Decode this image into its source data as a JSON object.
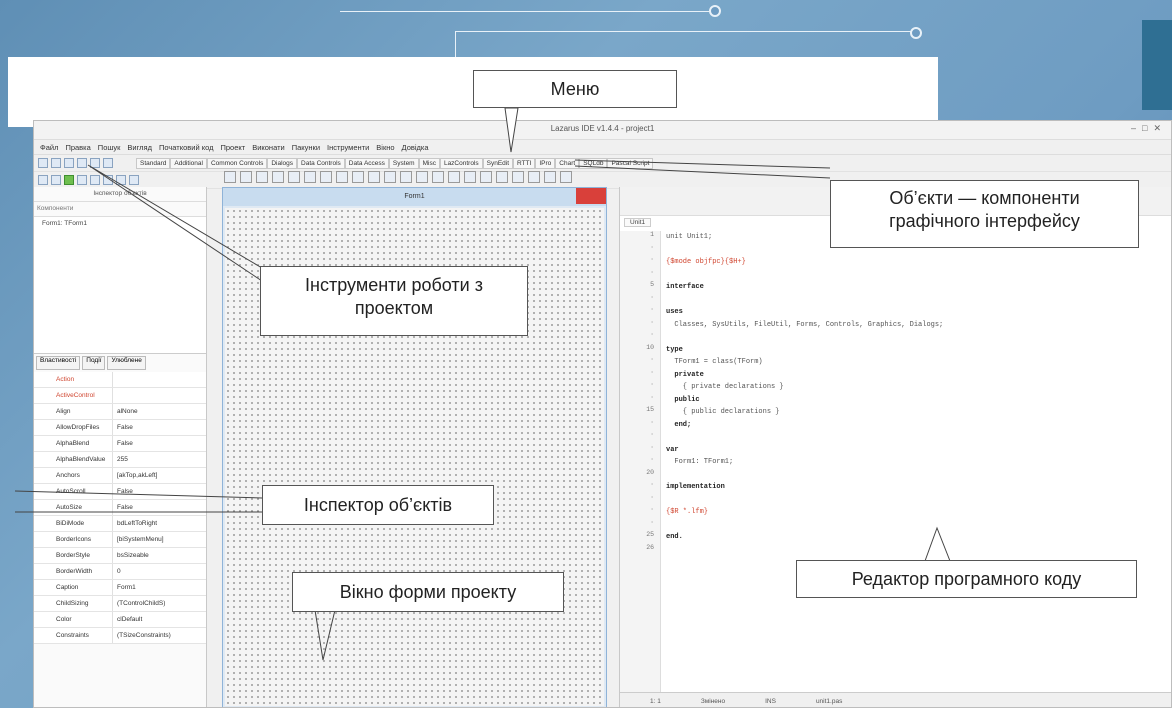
{
  "callouts": {
    "menu": "Меню",
    "objects": "Об’єкти — компоненти графічного інтерфейсу",
    "tools": "Інструменти роботи з проектом",
    "inspector": "Інспектор об’єктів",
    "form_window": "Вікно форми проекту",
    "code_editor": "Редактор програмного коду"
  },
  "ide": {
    "title": "Lazarus IDE v1.4.4 - project1",
    "menu_items": [
      "Файл",
      "Правка",
      "Пошук",
      "Вигляд",
      "Початковий код",
      "Проект",
      "Виконати",
      "Пакунки",
      "Інструменти",
      "Вікно",
      "Довідка"
    ],
    "palette_tabs": [
      "Standard",
      "Additional",
      "Common Controls",
      "Dialogs",
      "Data Controls",
      "Data Access",
      "System",
      "Misc",
      "LazControls",
      "SynEdit",
      "RTTI",
      "IPro",
      "Chart",
      "SQLdb",
      "Pascal Script"
    ]
  },
  "inspector": {
    "header": "Інспектор об'єктів",
    "search_label": "Компоненти",
    "tree_item": "Form1: TForm1",
    "tabs": [
      "Властивості",
      "Події",
      "Улюблене"
    ],
    "properties": [
      {
        "name": "Action",
        "value": ""
      },
      {
        "name": "ActiveControl",
        "value": ""
      },
      {
        "name": "Align",
        "value": "alNone"
      },
      {
        "name": "AllowDropFiles",
        "value": "False"
      },
      {
        "name": "AlphaBlend",
        "value": "False"
      },
      {
        "name": "AlphaBlendValue",
        "value": "255"
      },
      {
        "name": "Anchors",
        "value": "[akTop,akLeft]"
      },
      {
        "name": "AutoScroll",
        "value": "False"
      },
      {
        "name": "AutoSize",
        "value": "False"
      },
      {
        "name": "BiDiMode",
        "value": "bdLeftToRight"
      },
      {
        "name": "BorderIcons",
        "value": "[biSystemMenu]"
      },
      {
        "name": "BorderStyle",
        "value": "bsSizeable"
      },
      {
        "name": "BorderWidth",
        "value": "0"
      },
      {
        "name": "Caption",
        "value": "Form1"
      },
      {
        "name": "ChildSizing",
        "value": "(TControlChildS)"
      },
      {
        "name": "Color",
        "value": "clDefault"
      },
      {
        "name": "Constraints",
        "value": "(TSizeConstraints)"
      }
    ]
  },
  "form": {
    "title": "Form1"
  },
  "editor": {
    "tab": "Unit1",
    "code_lines": [
      {
        "n": "1",
        "t": "unit Unit1;",
        "c": ""
      },
      {
        "n": "",
        "t": "",
        "c": ""
      },
      {
        "n": "",
        "t": "{$mode objfpc}{$H+}",
        "c": "red"
      },
      {
        "n": "",
        "t": "",
        "c": ""
      },
      {
        "n": "5",
        "t": "interface",
        "c": "blk"
      },
      {
        "n": "",
        "t": "",
        "c": ""
      },
      {
        "n": "",
        "t": "uses",
        "c": "blk"
      },
      {
        "n": "",
        "t": "  Classes, SysUtils, FileUtil, Forms, Controls, Graphics, Dialogs;",
        "c": ""
      },
      {
        "n": "",
        "t": "",
        "c": ""
      },
      {
        "n": "10",
        "t": "type",
        "c": "blk"
      },
      {
        "n": "",
        "t": "  TForm1 = class(TForm)",
        "c": ""
      },
      {
        "n": "",
        "t": "  private",
        "c": "blk"
      },
      {
        "n": "",
        "t": "    { private declarations }",
        "c": ""
      },
      {
        "n": "",
        "t": "  public",
        "c": "blk"
      },
      {
        "n": "15",
        "t": "    { public declarations }",
        "c": ""
      },
      {
        "n": "",
        "t": "  end;",
        "c": "blk"
      },
      {
        "n": "",
        "t": "",
        "c": ""
      },
      {
        "n": "",
        "t": "var",
        "c": "blk"
      },
      {
        "n": "",
        "t": "  Form1: TForm1;",
        "c": ""
      },
      {
        "n": "20",
        "t": "",
        "c": ""
      },
      {
        "n": "",
        "t": "implementation",
        "c": "blk"
      },
      {
        "n": "",
        "t": "",
        "c": ""
      },
      {
        "n": "",
        "t": "{$R *.lfm}",
        "c": "red"
      },
      {
        "n": "",
        "t": "",
        "c": ""
      },
      {
        "n": "25",
        "t": "end.",
        "c": "blk"
      },
      {
        "n": "26",
        "t": "",
        "c": ""
      }
    ],
    "status": [
      "1: 1",
      "Змінено",
      "INS",
      "unit1.pas"
    ]
  }
}
